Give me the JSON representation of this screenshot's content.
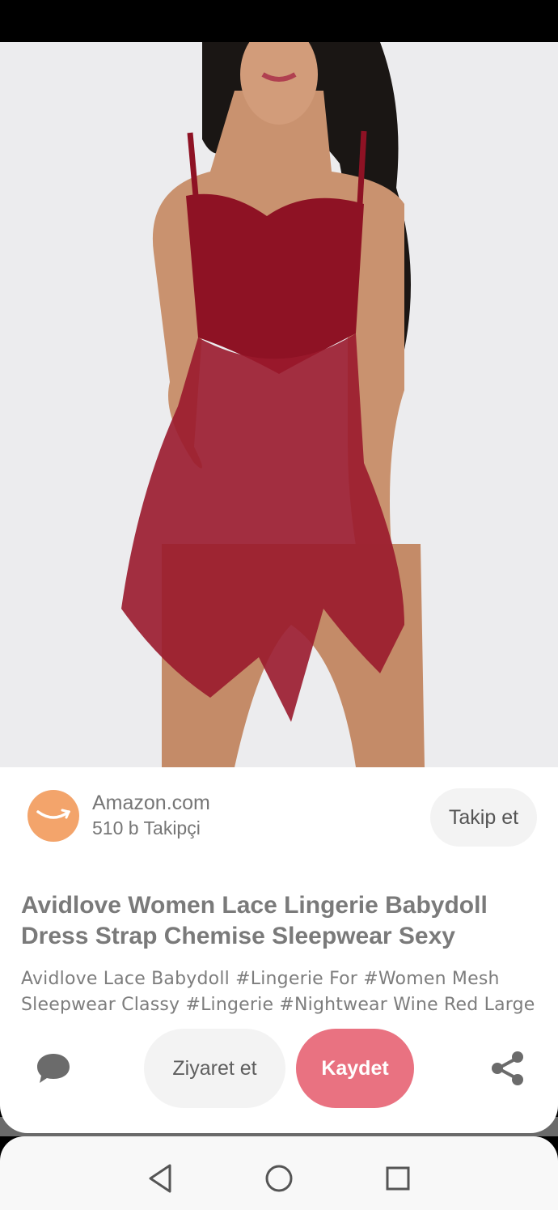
{
  "pin": {
    "image_subject": "product-photo",
    "source": {
      "name": "Amazon.com",
      "followers": "510 b Takipçi",
      "avatar_color": "#f3a46b",
      "follow_label": "Takip et"
    },
    "title": "Avidlove Women Lace Lingerie Babydoll Dress Strap Chemise Sleepwear Sexy",
    "description": "Avidlove Lace Babydoll #Lingerie For #Women Mesh Sleepwear Classy #Lingerie #Nightwear Wine Red Large"
  },
  "actions": {
    "comment_icon": "comment-bubble-icon",
    "visit_label": "Ziyaret et",
    "save_label": "Kaydet",
    "save_color": "#e97281",
    "share_icon": "share-icon"
  },
  "navigation": {
    "back_icon": "back-triangle-icon",
    "home_icon": "home-circle-icon",
    "recents_icon": "recents-square-icon"
  }
}
